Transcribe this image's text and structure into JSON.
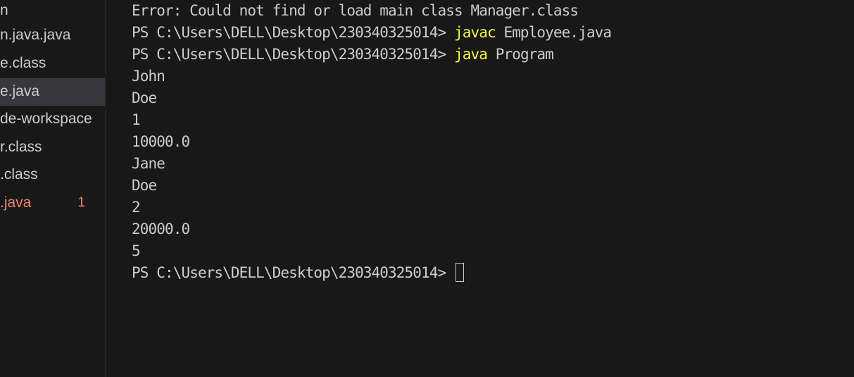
{
  "explorer": {
    "items": [
      {
        "label": "n",
        "selected": false,
        "error": false,
        "badge": ""
      },
      {
        "label": "n.java.java",
        "selected": false,
        "error": false,
        "badge": ""
      },
      {
        "label": "e.class",
        "selected": false,
        "error": false,
        "badge": ""
      },
      {
        "label": "e.java",
        "selected": true,
        "error": false,
        "badge": ""
      },
      {
        "label": "de-workspace",
        "selected": false,
        "error": false,
        "badge": ""
      },
      {
        "label": "r.class",
        "selected": false,
        "error": false,
        "badge": ""
      },
      {
        "label": ".class",
        "selected": false,
        "error": false,
        "badge": ""
      },
      {
        "label": ".java",
        "selected": false,
        "error": true,
        "badge": "1"
      }
    ]
  },
  "terminal": {
    "lines": [
      {
        "prompt": "",
        "cmd": "",
        "args": "Error: Could not find or load main class Manager.class"
      },
      {
        "prompt": "PS C:\\Users\\DELL\\Desktop\\230340325014> ",
        "cmd": "javac",
        "args": " Employee.java"
      },
      {
        "prompt": "PS C:\\Users\\DELL\\Desktop\\230340325014> ",
        "cmd": "java",
        "args": " Program"
      },
      {
        "prompt": "",
        "cmd": "",
        "args": "John"
      },
      {
        "prompt": "",
        "cmd": "",
        "args": "Doe"
      },
      {
        "prompt": "",
        "cmd": "",
        "args": "1"
      },
      {
        "prompt": "",
        "cmd": "",
        "args": "10000.0"
      },
      {
        "prompt": "",
        "cmd": "",
        "args": "Jane"
      },
      {
        "prompt": "",
        "cmd": "",
        "args": "Doe"
      },
      {
        "prompt": "",
        "cmd": "",
        "args": "2"
      },
      {
        "prompt": "",
        "cmd": "",
        "args": "20000.0"
      },
      {
        "prompt": "",
        "cmd": "",
        "args": "5"
      },
      {
        "prompt": "PS C:\\Users\\DELL\\Desktop\\230340325014>",
        "cmd": "",
        "args": ""
      }
    ]
  },
  "colors": {
    "background": "#181818",
    "text": "#cccccc",
    "command": "#f5f543",
    "error": "#f48771",
    "selection": "#37373d"
  }
}
